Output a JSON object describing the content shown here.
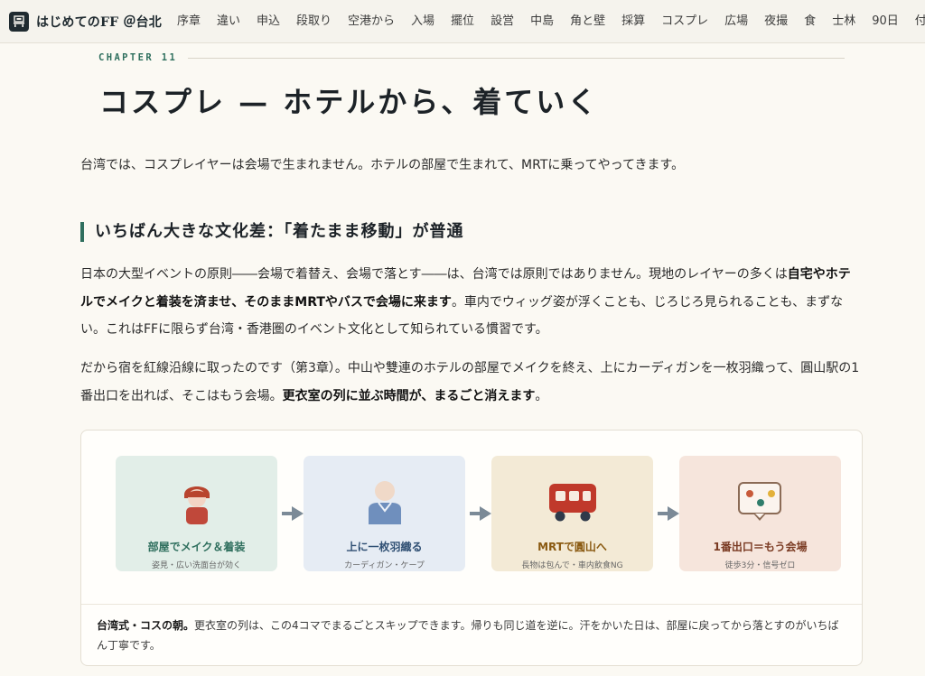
{
  "header": {
    "site_title": "はじめてのFF ＠台北",
    "nav": [
      "序章",
      "違い",
      "申込",
      "段取り",
      "空港から",
      "入場",
      "擺位",
      "設営",
      "中島",
      "角と壁",
      "採算",
      "コスプレ",
      "広場",
      "夜撮",
      "食",
      "士林",
      "90日",
      "付録"
    ]
  },
  "chapter": {
    "label": "CHAPTER 11",
    "title": "コスプレ — ホテルから、着ていく"
  },
  "lead": "台湾では、コスプレイヤーは会場で生まれません。ホテルの部屋で生まれて、MRTに乗ってやってきます。",
  "section": {
    "heading": "いちばん大きな文化差：「着たまま移動」が普通",
    "p1": {
      "a": "日本の大型イベントの原則――会場で着替え、会場で落とす――は、台湾では原則ではありません。現地のレイヤーの多くは",
      "b": "自宅やホテルでメイクと着装を済ませ、そのままMRTやバスで会場に来ます",
      "c": "。車内でウィッグ姿が浮くことも、じろじろ見られることも、まずない。これはFFに限らず台湾・香港圏のイベント文化として知られている慣習です。"
    },
    "p2": {
      "a": "だから宿を紅線沿線に取ったのです（第3章）。中山や雙連のホテルの部屋でメイクを終え、上にカーディガンを一枚羽織って、圓山駅の1番出口を出れば、そこはもう会場。",
      "b": "更衣室の列に並ぶ時間が、まるごと消えます",
      "c": "。"
    }
  },
  "figure": {
    "steps": [
      {
        "title": "部屋でメイク＆着装",
        "sub": "姿見・広い洗面台が効く",
        "bg": "#e2eee8",
        "color": "#2f6f5e",
        "icon": "cosplayer-icon"
      },
      {
        "title": "上に一枚羽織る",
        "sub": "カーディガン・ケープ",
        "bg": "#e6ecf4",
        "color": "#2f4f73",
        "icon": "person-cardigan-icon"
      },
      {
        "title": "MRTで圓山へ",
        "sub": "長物は包んで・車内飲食NG",
        "bg": "#f3ead6",
        "color": "#8a5a12",
        "icon": "train-icon"
      },
      {
        "title": "1番出口＝もう会場",
        "sub": "徒歩3分・信号ゼロ",
        "bg": "#f6e5dc",
        "color": "#7a3a22",
        "icon": "venue-sign-icon"
      }
    ],
    "caption": {
      "bold": "台湾式・コスの朝。",
      "text": "更衣室の列は、この4コマでまるごとスキップできます。帰りも同じ道を逆に。汗をかいた日は、部屋に戻ってから落とすのがいちばん丁寧です。"
    }
  }
}
